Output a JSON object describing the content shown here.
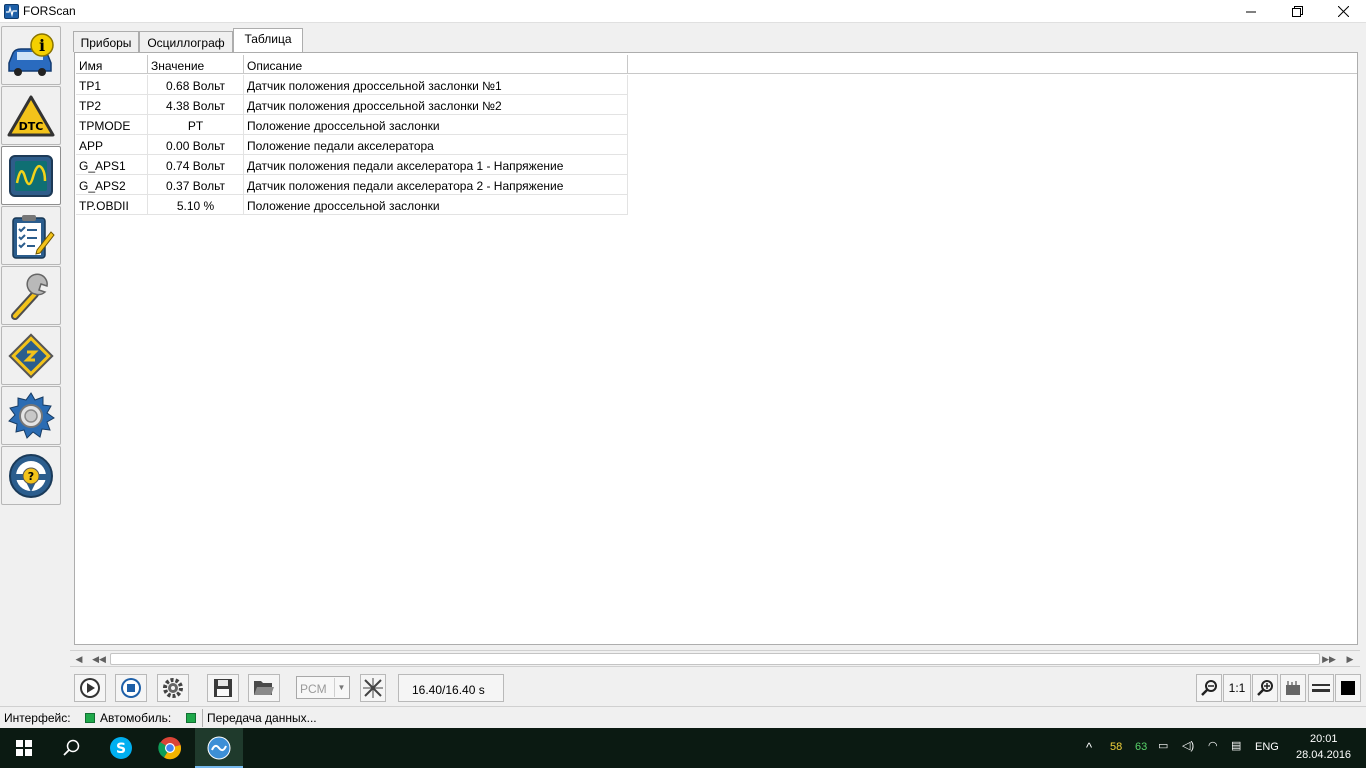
{
  "window": {
    "title": "FORScan"
  },
  "tabs": [
    {
      "label": "Приборы",
      "active": false
    },
    {
      "label": "Осциллограф",
      "active": false
    },
    {
      "label": "Таблица",
      "active": true
    }
  ],
  "table": {
    "columns": [
      "Имя",
      "Значение",
      "Описание"
    ],
    "rows": [
      {
        "name": "TP1",
        "value": "0.68 Вольт",
        "description": "Датчик положения дроссельной заслонки №1"
      },
      {
        "name": "TP2",
        "value": "4.38 Вольт",
        "description": "Датчик положения дроссельной заслонки №2"
      },
      {
        "name": "TPMODE",
        "value": "PT",
        "description": "Положение дроссельной заслонки"
      },
      {
        "name": "APP",
        "value": "0.00 Вольт",
        "description": "Положение педали акселератора"
      },
      {
        "name": "G_APS1",
        "value": "0.74 Вольт",
        "description": "Датчик положения педали акселератора 1 - Напряжение"
      },
      {
        "name": "G_APS2",
        "value": "0.37 Вольт",
        "description": "Датчик положения педали акселератора 2 - Напряжение"
      },
      {
        "name": "TP.OBDII",
        "value": "5.10 %",
        "description": "Положение дроссельной заслонки"
      }
    ]
  },
  "toolbar": {
    "module_select": "PCM",
    "time": "16.40/16.40 s",
    "zoom_ratio": "1:1"
  },
  "status": {
    "interface_label": "Интерфейс:",
    "vehicle_label": "Автомобиль:",
    "message": "Передача данных...",
    "led_color": "#1fa84a"
  },
  "taskbar": {
    "temp1": "58",
    "temp2": "63",
    "language": "ENG",
    "time": "20:01",
    "date": "28.04.2016"
  },
  "colors": {
    "taskbar_bg": "#0b1a12",
    "accent": "#1d5fa8"
  }
}
